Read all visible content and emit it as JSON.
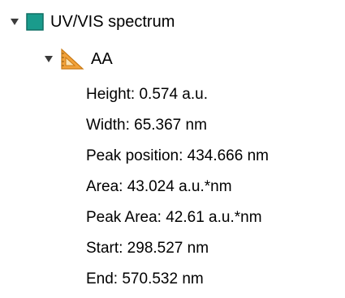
{
  "tree": {
    "root": {
      "label": "UV/VIS spectrum",
      "expanded": true,
      "icon": "teal-square-icon",
      "icon_color": "#1a9b8c",
      "children": [
        {
          "label": "AA",
          "expanded": true,
          "icon": "set-square-ruler-icon",
          "icon_color": "#f2a23a",
          "properties": [
            "Height: 0.574 a.u.",
            "Width: 65.367 nm",
            "Peak position: 434.666 nm",
            "Area: 43.024 a.u.*nm",
            "Peak Area: 42.61 a.u.*nm",
            "Start: 298.527 nm",
            "End: 570.532 nm"
          ]
        }
      ]
    }
  }
}
